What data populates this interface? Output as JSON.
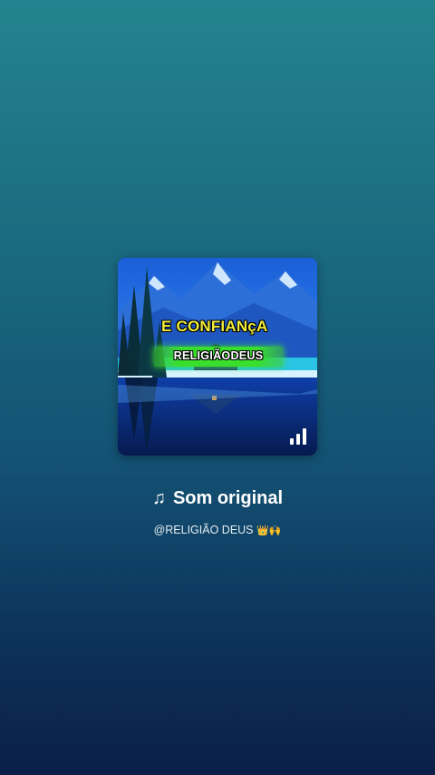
{
  "sound": {
    "title": "Som original",
    "note_icon": "♫",
    "author": "@RELIGIÃO DEUS",
    "author_emoji": "👑🙌",
    "cover": {
      "caption_top": "E CONFIANçA",
      "caption_bottom": "RELIGIÃODEUS",
      "audio_bars_icon": "audio-bars-icon"
    }
  }
}
